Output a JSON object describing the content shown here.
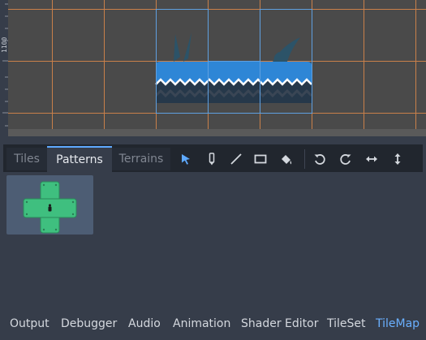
{
  "viewport": {
    "ruler_label": "1100",
    "colors": {
      "background": "#4a4a4a",
      "grid": "#e08a4a",
      "selection": "#5fa0e0",
      "water": "#2e86d6",
      "water_dark": "#26384a",
      "weeds": "#2c5368"
    }
  },
  "tilemap": {
    "tabs": [
      {
        "label": "Tiles",
        "active": false
      },
      {
        "label": "Patterns",
        "active": true
      },
      {
        "label": "Terrains",
        "active": false
      }
    ],
    "tools": [
      {
        "icon": "select-cursor-icon",
        "active": true
      },
      {
        "icon": "paint-pencil-icon",
        "active": false
      },
      {
        "icon": "line-icon",
        "active": false
      },
      {
        "icon": "rectangle-icon",
        "active": false
      },
      {
        "icon": "bucket-fill-icon",
        "active": false
      },
      {
        "icon": "rotate-left-icon",
        "active": false
      },
      {
        "icon": "rotate-right-icon",
        "active": false
      },
      {
        "icon": "flip-horizontal-icon",
        "active": false
      },
      {
        "icon": "flip-vertical-icon",
        "active": false
      }
    ],
    "patterns": [
      {
        "icon": "green-cross-pattern-icon",
        "selected": true
      }
    ],
    "accent_color": "#5ea9ff"
  },
  "bottom_panel": {
    "tabs": [
      {
        "label": "Output",
        "active": false
      },
      {
        "label": "Debugger",
        "active": false
      },
      {
        "label": "Audio",
        "active": false
      },
      {
        "label": "Animation",
        "active": false
      },
      {
        "label": "Shader Editor",
        "active": false
      },
      {
        "label": "TileSet",
        "active": false
      },
      {
        "label": "TileMap",
        "active": true
      }
    ]
  }
}
